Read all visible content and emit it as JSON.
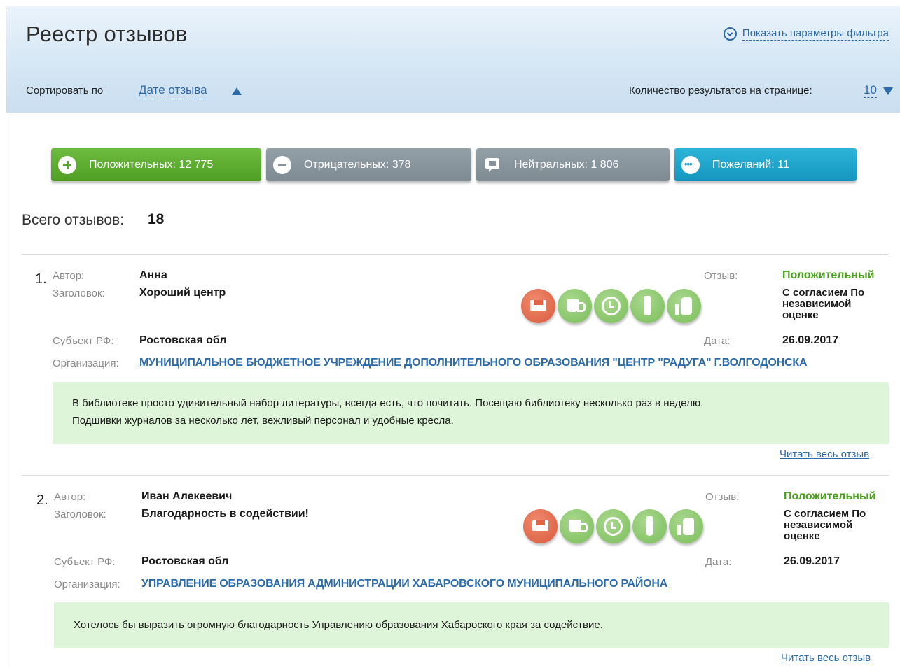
{
  "header": {
    "title": "Реестр отзывов",
    "filter_toggle_label": "Показать параметры фильтра",
    "sort_label": "Сортировать по",
    "sort_value": "Дате отзыва",
    "per_page_label": "Количество результатов на странице:",
    "per_page_value": "10"
  },
  "stats": {
    "positive": "Положительных: 12 775",
    "negative": "Отрицательных: 378",
    "neutral": "Нейтральных: 1 806",
    "wishes": "Пожеланий: 11"
  },
  "total": {
    "label": "Всего отзывов:",
    "value": "18"
  },
  "labels": {
    "author": "Автор:",
    "title": "Заголовок:",
    "region": "Субъект РФ:",
    "organization": "Организация:",
    "review": "Отзыв:",
    "date": "Дата:",
    "read_more": "Читать весь отзыв"
  },
  "reviews": [
    {
      "number": "1.",
      "author": "Анна",
      "title": "Хороший центр",
      "region": "Ростовская обл",
      "organization": "МУНИЦИПАЛЬНОЕ БЮДЖЕТНОЕ УЧРЕЖДЕНИЕ ДОПОЛНИТЕЛЬНОГО ОБРАЗОВАНИЯ \"ЦЕНТР \"РАДУГА\" Г.ВОЛГОДОНСКА",
      "type": "Положительный",
      "consent": "С согласием По независимой оценке",
      "date": "26.09.2017",
      "text_line1": "В библиотеке просто удивительный набор литературы, всегда есть, что почитать. Посещаю библиотеку несколько раз в неделю.",
      "text_line2": "Подшивки журналов за несколько лет, вежливый персонал и удобные кресла."
    },
    {
      "number": "2.",
      "author": "Иван Алекеевич",
      "title": "Благодарность в содействии!",
      "region": "Ростовская обл",
      "organization": "УПРАВЛЕНИЕ ОБРАЗОВАНИЯ АДМИНИСТРАЦИИ ХАБАРОВСКОГО МУНИЦИПАЛЬНОГО РАЙОНА",
      "type": "Положительный",
      "consent": "С согласием По независимой оценке",
      "date": "26.09.2017",
      "text_line1": "Хотелось бы выразить огромную благодарность Управлению образования Хабароского края за содействие."
    }
  ],
  "colors": {
    "accent_blue": "#2d6aa8",
    "positive_green": "#4f9f24",
    "neutral_gray": "#86939b",
    "wish_blue": "#1596c0",
    "review_bg": "#dff5d9"
  },
  "icons": {
    "filter": "chevron-circle-down-icon",
    "badges": [
      "tray-icon",
      "cup-icon",
      "clock-icon",
      "tie-icon",
      "thumbs-up-icon"
    ]
  }
}
